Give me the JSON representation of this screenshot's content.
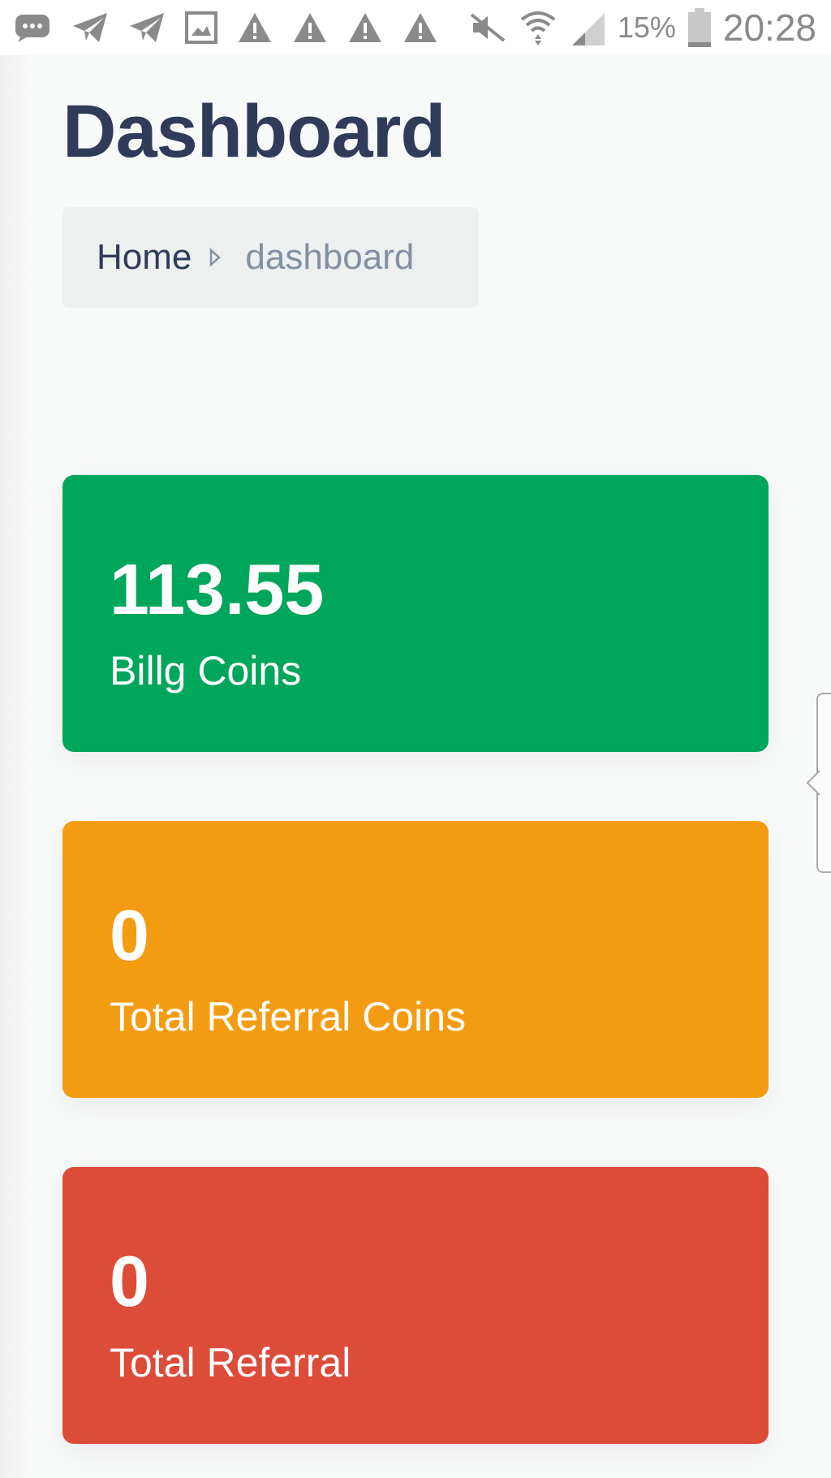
{
  "status_bar": {
    "icons_left": [
      "message-icon",
      "telegram-icon",
      "telegram-icon",
      "gallery-icon",
      "warning-icon",
      "warning-icon",
      "warning-icon",
      "warning-icon"
    ],
    "icons_right": [
      "mute-icon",
      "wifi-icon",
      "signal-icon",
      "battery-icon"
    ],
    "battery": "15%",
    "time": "20:28"
  },
  "page": {
    "title": "Dashboard"
  },
  "breadcrumb": {
    "home": "Home",
    "current": "dashboard"
  },
  "cards": [
    {
      "value": "113.55",
      "label": "Billg Coins",
      "color": "#00a65a"
    },
    {
      "value": "0",
      "label": "Total Referral Coins",
      "color": "#f39c12"
    },
    {
      "value": "0",
      "label": "Total Referral",
      "color": "#dd4b39"
    }
  ]
}
